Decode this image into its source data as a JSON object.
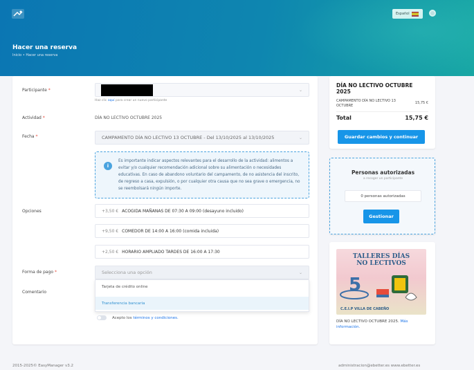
{
  "header": {
    "language_label": "Español",
    "page_title": "Hacer una reserva",
    "breadcrumb": "Inicio  •  Hacer una reserva"
  },
  "form": {
    "participant_label": "Participante",
    "participant_hint_prefix": "Haz clic",
    "participant_hint_link": "aquí",
    "participant_hint_suffix": "para crear un nuevo participante",
    "activity_label": "Actividad",
    "activity_value": "DÍA NO LECTIVO OCTUBRE 2025",
    "date_label": "Fecha",
    "date_value": "CAMPAMENTO DÍA NO LECTIVO 13 OCTUBRE - Del 13/10/2025 al 13/10/2025",
    "info_text": "Es importante indicar aspectos relevantes para el desarrollo de la actividad: alimentos a evitar y/o cualquier recomendación adicional sobre su alimentación o necesidades educativas. En caso de abandono voluntario del campamento, de no asistencia del inscrito, de regreso a casa, expulsión, o por cualquier otra causa que no sea grave o emergencia, no se reembolsará ningún importe.",
    "options_label": "Opciones",
    "options": [
      {
        "price": "+3,50 €",
        "name": "ACOGIDA MAÑANAS DE 07:30 A 09:00 (desayuno incluido)"
      },
      {
        "price": "+9,50 €",
        "name": "COMEDOR DE 14:00 A 16:00 (comida incluida)"
      },
      {
        "price": "+2,50 €",
        "name": "HORARIO AMPLIADO TARDES DE 16:00 A 17:30"
      }
    ],
    "payment_label": "Forma de pago",
    "payment_placeholder": "Selecciona una opción",
    "payment_options": [
      "Tarjeta de crédito online",
      "Transferencia bancaria"
    ],
    "comment_label": "Comentario",
    "terms_prefix": "Acepto los",
    "terms_link": "términos y condiciones."
  },
  "summary": {
    "title": "DÍA NO LECTIVO OCTUBRE 2025",
    "line_desc": "CAMPAMENTO DÍA NO LECTIVO 13 OCTUBRE",
    "line_amount": "15,75 €",
    "total_label": "Total",
    "total_amount": "15,75 €",
    "save_button": "Guardar cambios y continuar"
  },
  "authorized": {
    "title": "Personas autorizadas",
    "subtitle": "a recoger un participante",
    "count": "0 personas autorizadas",
    "manage_button": "Gestionar"
  },
  "promo": {
    "poster_title_1": "TALLERES DÍAS",
    "poster_title_2": "NO LECTIVOS",
    "poster_footer": "C.E.I.P VILLA DE CABEÑO",
    "text": "DÍA NO LECTIVO OCTUBRE 2025.",
    "link": "Más información."
  },
  "footer": {
    "left": "2015-2025© EasyManager v3.2",
    "right": "administracion@ebetter.es    www.ebetter.es"
  },
  "colors": {
    "primary": "#1795e8",
    "header_start": "#0b76b3",
    "header_end": "#18a7a4",
    "required": "#e74c3c"
  }
}
